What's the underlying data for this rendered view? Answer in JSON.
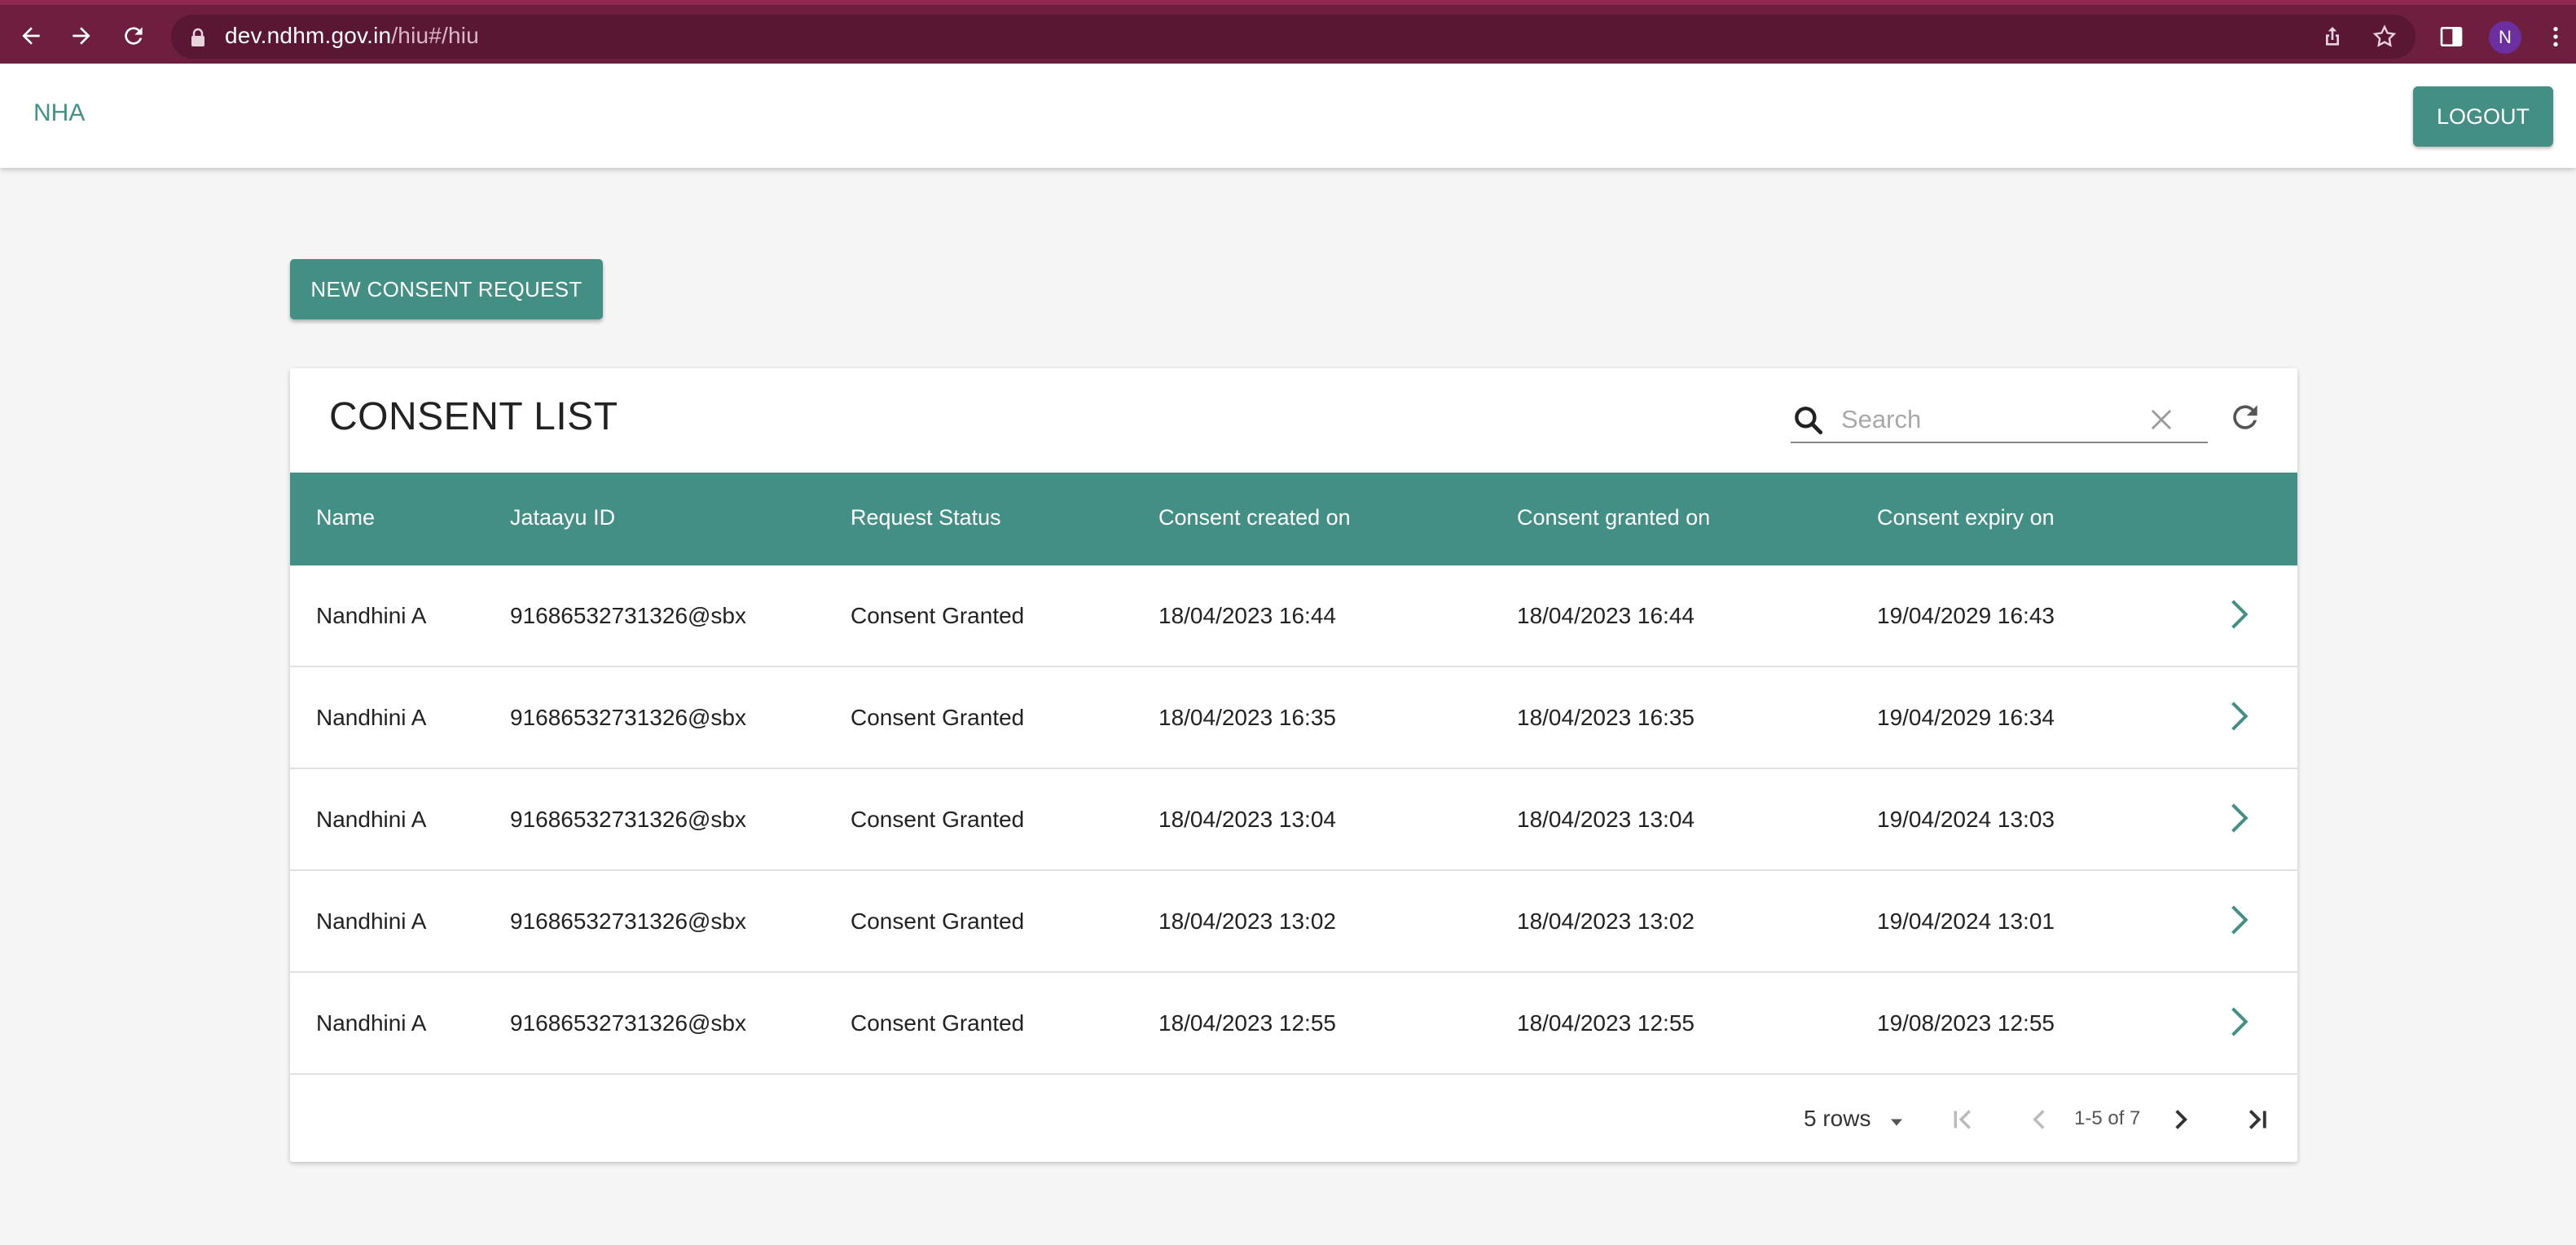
{
  "browser": {
    "url_host": "dev.ndhm.gov.in",
    "url_path": "/hiu#/hiu",
    "profile_initial": "N"
  },
  "app": {
    "brand": "NHA",
    "logout_label": "LOGOUT",
    "new_request_label": "NEW CONSENT REQUEST"
  },
  "consent_list": {
    "title": "CONSENT LIST",
    "search_placeholder": "Search",
    "columns": [
      "Name",
      "Jataayu ID",
      "Request Status",
      "Consent created on",
      "Consent granted on",
      "Consent expiry on"
    ],
    "rows": [
      {
        "name": "Nandhini A",
        "id": "91686532731326@sbx",
        "status": "Consent Granted",
        "created": "18/04/2023 16:44",
        "granted": "18/04/2023 16:44",
        "expiry": "19/04/2029 16:43"
      },
      {
        "name": "Nandhini A",
        "id": "91686532731326@sbx",
        "status": "Consent Granted",
        "created": "18/04/2023 16:35",
        "granted": "18/04/2023 16:35",
        "expiry": "19/04/2029 16:34"
      },
      {
        "name": "Nandhini A",
        "id": "91686532731326@sbx",
        "status": "Consent Granted",
        "created": "18/04/2023 13:04",
        "granted": "18/04/2023 13:04",
        "expiry": "19/04/2024 13:03"
      },
      {
        "name": "Nandhini A",
        "id": "91686532731326@sbx",
        "status": "Consent Granted",
        "created": "18/04/2023 13:02",
        "granted": "18/04/2023 13:02",
        "expiry": "19/04/2024 13:01"
      },
      {
        "name": "Nandhini A",
        "id": "91686532731326@sbx",
        "status": "Consent Granted",
        "created": "18/04/2023 12:55",
        "granted": "18/04/2023 12:55",
        "expiry": "19/08/2023 12:55"
      }
    ],
    "pagination": {
      "rows_per_page": "5 rows",
      "page_info": "1-5 of 7"
    }
  },
  "colors": {
    "accent": "#438f84",
    "chrome": "#6e1e3e"
  }
}
